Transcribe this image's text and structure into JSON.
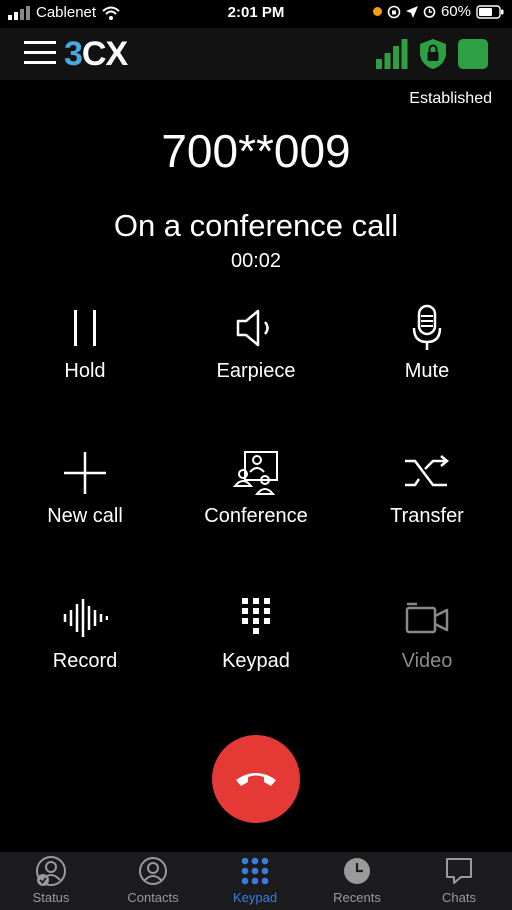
{
  "status_bar": {
    "carrier": "Cablenet",
    "time": "2:01 PM",
    "battery": "60%"
  },
  "app": {
    "logo_a": "3",
    "logo_b": "CX"
  },
  "call": {
    "state": "Established",
    "number": "700**009",
    "title": "On a conference call",
    "timer": "00:02"
  },
  "controls": {
    "hold": "Hold",
    "earpiece": "Earpiece",
    "mute": "Mute",
    "new_call": "New call",
    "conference": "Conference",
    "transfer": "Transfer",
    "record": "Record",
    "keypad": "Keypad",
    "video": "Video"
  },
  "tabs": {
    "status": "Status",
    "contacts": "Contacts",
    "keypad": "Keypad",
    "recents": "Recents",
    "chats": "Chats"
  },
  "colors": {
    "accent": "#3b7ddd",
    "hangup": "#e53935",
    "status_green": "#2ea043",
    "logo_blue": "#4aa8e0"
  }
}
